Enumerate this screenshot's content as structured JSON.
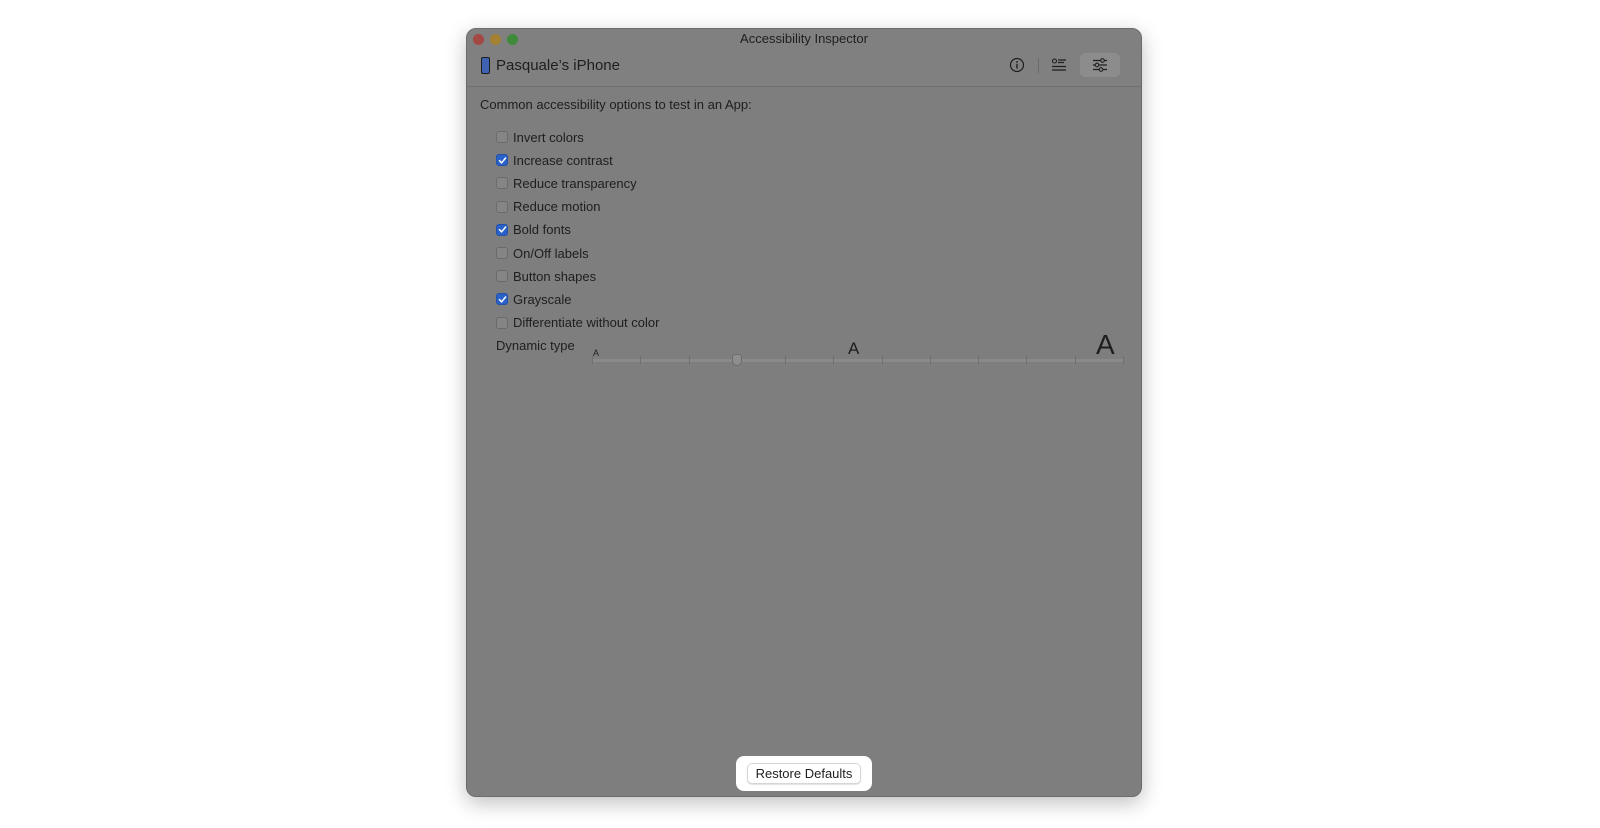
{
  "window": {
    "title": "Accessibility Inspector",
    "traffic_lights": {
      "close": "#a34843",
      "minimize": "#a58133",
      "maximize": "#3f8b3b"
    }
  },
  "device": {
    "name": "Pasquale’s iPhone",
    "icon": "iphone-icon"
  },
  "toolbar": {
    "buttons": [
      {
        "name": "inspection-icon",
        "selected": false
      },
      {
        "name": "audit-list-icon",
        "selected": false
      },
      {
        "name": "settings-sliders-icon",
        "selected": true
      }
    ]
  },
  "content": {
    "intro": "Common accessibility options to test in an App:",
    "options": [
      {
        "label": "Invert colors",
        "checked": false
      },
      {
        "label": "Increase contrast",
        "checked": true
      },
      {
        "label": "Reduce transparency",
        "checked": false
      },
      {
        "label": "Reduce motion",
        "checked": false
      },
      {
        "label": "Bold fonts",
        "checked": true
      },
      {
        "label": "On/Off labels",
        "checked": false
      },
      {
        "label": "Button shapes",
        "checked": false
      },
      {
        "label": "Grayscale",
        "checked": true
      },
      {
        "label": "Differentiate without color",
        "checked": false
      }
    ],
    "dynamic_type": {
      "label": "Dynamic type",
      "small_glyph": "A",
      "mid_glyph": "A",
      "large_glyph": "A",
      "steps": 12,
      "current_step": 3
    }
  },
  "footer": {
    "restore_label": "Restore Defaults"
  },
  "colors": {
    "accent": "#2a62c9",
    "window_bg": "#7e7e7e"
  }
}
